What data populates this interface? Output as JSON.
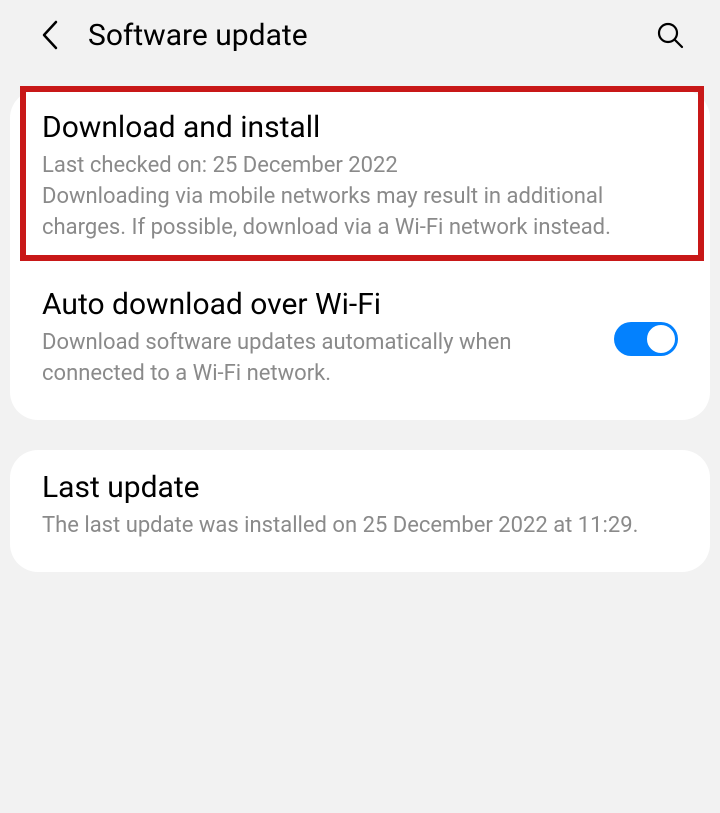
{
  "header": {
    "title": "Software update"
  },
  "downloadInstall": {
    "title": "Download and install",
    "lastChecked": "Last checked on: 25 December 2022",
    "warning": "Downloading via mobile networks may result in additional charges. If possible, download via a Wi-Fi network instead."
  },
  "autoDownload": {
    "title": "Auto download over Wi-Fi",
    "desc": "Download software updates automatically when connected to a Wi-Fi network.",
    "enabled": true
  },
  "lastUpdate": {
    "title": "Last update",
    "desc": "The last update was installed on 25 December 2022 at 11:29."
  }
}
